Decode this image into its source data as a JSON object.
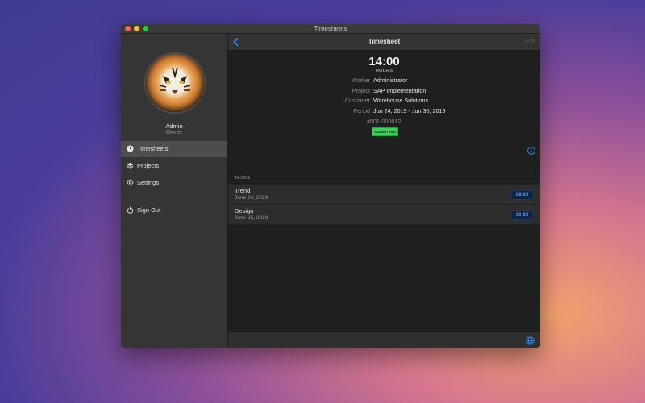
{
  "window": {
    "title": "Timesheets"
  },
  "profile": {
    "name": "Admin",
    "role": "Owner"
  },
  "sidebar": {
    "items": [
      {
        "label": "Timesheets",
        "icon": "clock-icon",
        "active": true
      },
      {
        "label": "Projects",
        "icon": "layers-icon",
        "active": false
      },
      {
        "label": "Settings",
        "icon": "gear-icon",
        "active": false
      },
      {
        "label": "Sign Out",
        "icon": "power-icon",
        "active": false
      }
    ]
  },
  "toolbar": {
    "title": "Timesheet",
    "edit_label": "Edit"
  },
  "timesheet": {
    "hours": "14:00",
    "hours_label": "HOURS",
    "details": [
      {
        "key": "Worker",
        "value": "Administrator"
      },
      {
        "key": "Project",
        "value": "SAP Implementation"
      },
      {
        "key": "Customer",
        "value": "Warehouse Solutions"
      },
      {
        "key": "Period",
        "value": "Jun 24, 2019 - Jun 30, 2019"
      }
    ],
    "id": "#001-000012",
    "status": "SUBMITTED"
  },
  "tasks": {
    "header": "TASKS",
    "items": [
      {
        "name": "Trend",
        "date": "June 24, 2019",
        "hours": "08:00"
      },
      {
        "name": "Design",
        "date": "June 25, 2019",
        "hours": "06:00"
      }
    ]
  },
  "colors": {
    "accent": "#3a8df5",
    "status_green": "#39d353",
    "sidebar_bg": "#353535",
    "content_bg": "#1f1f1f"
  }
}
